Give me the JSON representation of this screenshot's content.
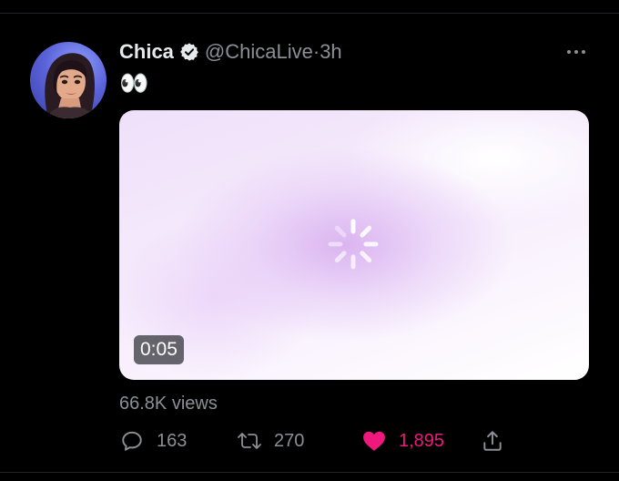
{
  "tweet": {
    "author_name": "Chica",
    "handle": "@ChicaLive",
    "separator": " · ",
    "time": "3h",
    "text": "👀",
    "media": {
      "duration": "0:05",
      "state": "loading"
    },
    "views": "66.8K views",
    "stats": {
      "replies": "163",
      "retweets": "270",
      "likes": "1,895"
    }
  },
  "icons": {
    "verified": "verified-badge-icon",
    "more": "more-dots-icon",
    "reply": "reply-bubble-icon",
    "retweet": "retweet-icon",
    "like": "heart-filled-icon",
    "share": "share-upload-icon",
    "spinner": "loading-spinner-icon"
  },
  "colors": {
    "background": "#000000",
    "text": "#e7e9ea",
    "secondary": "#8b9096",
    "like": "#f0187c"
  }
}
